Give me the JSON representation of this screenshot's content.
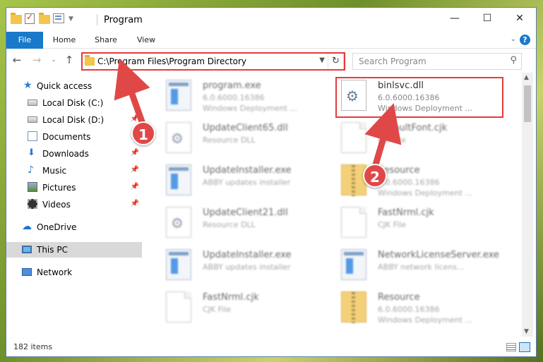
{
  "window": {
    "title": "Program"
  },
  "window_controls": {
    "minimize": "—",
    "maximize": "☐",
    "close": "✕"
  },
  "ribbon": {
    "tabs": [
      "File",
      "Home",
      "Share",
      "View"
    ],
    "help": "?"
  },
  "nav": {
    "address": "C:\\Program Files\\Program Directory",
    "search_placeholder": "Search Program"
  },
  "sidebar": {
    "items": [
      {
        "label": "Quick access",
        "icon": "star-icon"
      },
      {
        "label": "Local Disk (C:)",
        "icon": "disk-icon"
      },
      {
        "label": "Local Disk (D:)",
        "icon": "disk-icon",
        "pinned": true
      },
      {
        "label": "Documents",
        "icon": "documents-icon",
        "pinned": true
      },
      {
        "label": "Downloads",
        "icon": "downloads-icon",
        "pinned": true
      },
      {
        "label": "Music",
        "icon": "music-icon",
        "pinned": true
      },
      {
        "label": "Pictures",
        "icon": "pictures-icon",
        "pinned": true
      },
      {
        "label": "Videos",
        "icon": "videos-icon",
        "pinned": true
      },
      {
        "label": "OneDrive",
        "icon": "cloud-icon"
      },
      {
        "label": "This PC",
        "icon": "pc-icon",
        "selected": true
      },
      {
        "label": "Network",
        "icon": "network-icon"
      }
    ]
  },
  "files": [
    {
      "name": "program.exe",
      "line1": "6.0.6000.16386",
      "line2": "Windows Deployment ...",
      "type": "exe"
    },
    {
      "name": "binlsvc.dll",
      "line1": "6.0.6000.16386",
      "line2": "Windows Deployment ...",
      "type": "dll",
      "highlighted": true
    },
    {
      "name": "UpdateClient65.dll",
      "line1": "Resource DLL",
      "line2": "",
      "type": "dll"
    },
    {
      "name": "DefaultFont.cjk",
      "line1": "CJK File",
      "line2": "",
      "type": "doc"
    },
    {
      "name": "UpdateInstaller.exe",
      "line1": "ABBY updates installer",
      "line2": "",
      "type": "exe"
    },
    {
      "name": "Resource",
      "line1": "6.0.6000.16386",
      "line2": "Windows Deployment ...",
      "type": "zip"
    },
    {
      "name": "UpdateClient21.dll",
      "line1": "Resource DLL",
      "line2": "",
      "type": "dll"
    },
    {
      "name": "FastNrml.cjk",
      "line1": "CJK File",
      "line2": "",
      "type": "doc"
    },
    {
      "name": "UpdateInstaller.exe",
      "line1": "ABBY updates installer",
      "line2": "",
      "type": "exe"
    },
    {
      "name": "NetworkLicenseServer.exe",
      "line1": "ABBY network licens...",
      "line2": "",
      "type": "exe"
    },
    {
      "name": "FastNrml.cjk",
      "line1": "CJK File",
      "line2": "",
      "type": "doc"
    },
    {
      "name": "Resource",
      "line1": "6.0.6000.16386",
      "line2": "Windows Deployment ...",
      "type": "zip"
    }
  ],
  "status": {
    "item_count": "182 items"
  },
  "callouts": [
    {
      "number": "1"
    },
    {
      "number": "2"
    }
  ],
  "colors": {
    "accent": "#1979ca",
    "highlight": "#e53b3b",
    "badge": "#e04848"
  }
}
